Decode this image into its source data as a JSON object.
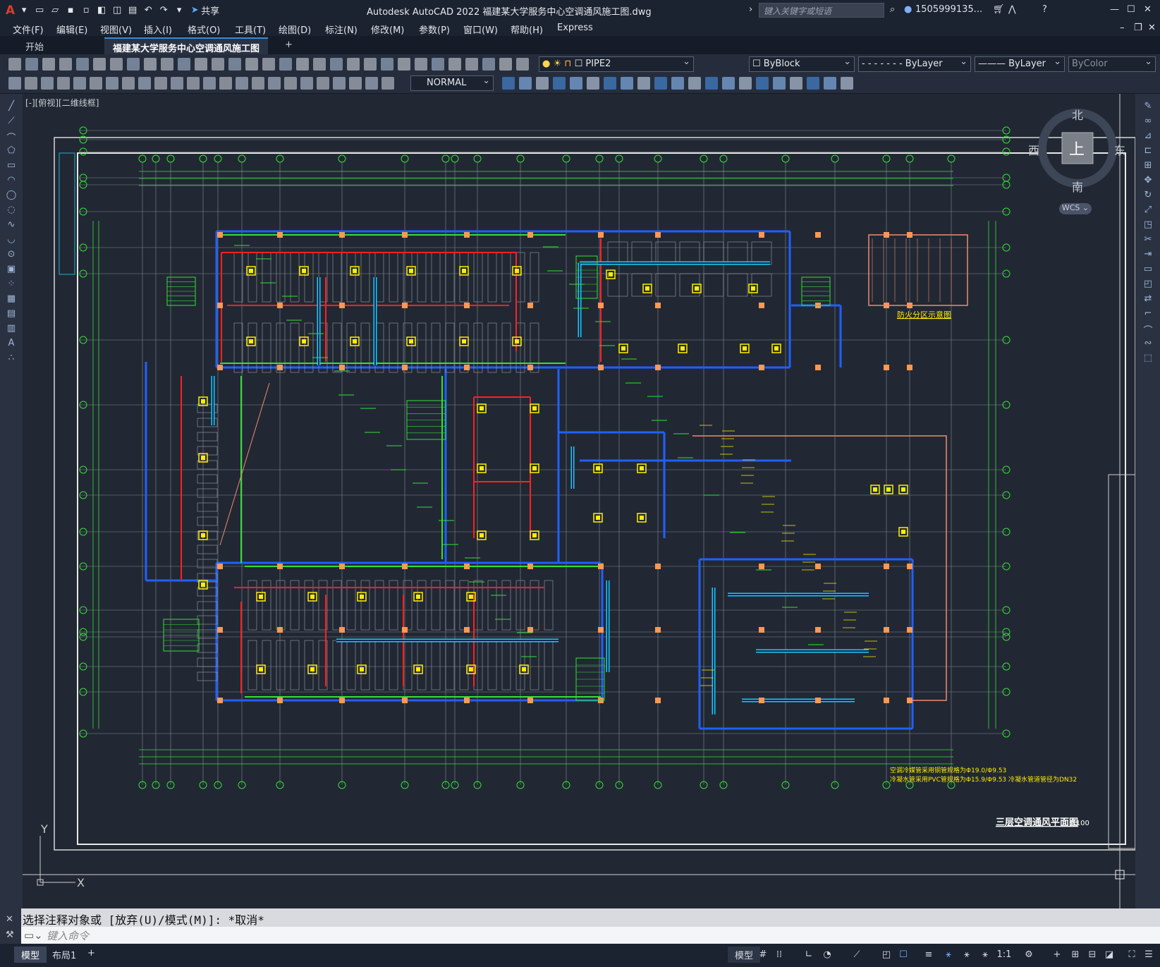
{
  "app": {
    "title": "Autodesk AutoCAD 2022    福建某大学服务中心空调通风施工图.dwg",
    "search_placeholder": "键入关键字或短语",
    "user": "1505999135...",
    "share": "共享"
  },
  "menu": [
    "文件(F)",
    "编辑(E)",
    "视图(V)",
    "插入(I)",
    "格式(O)",
    "工具(T)",
    "绘图(D)",
    "标注(N)",
    "修改(M)",
    "参数(P)",
    "窗口(W)",
    "帮助(H)",
    "Express"
  ],
  "tabs": {
    "start": "开始",
    "drawing": "福建某大学服务中心空调通风施工图*",
    "add": "+"
  },
  "properties": {
    "layer": "PIPE2",
    "color": "ByBlock",
    "linetype": "ByLayer",
    "lineweight": "ByLayer",
    "plotstyle": "ByColor",
    "dimstyle": "NORMAL"
  },
  "viewport": {
    "label": "[-][俯视][二维线框]"
  },
  "viewcube": {
    "north": "北",
    "south": "南",
    "east": "东",
    "west": "西",
    "top": "上",
    "wcs": "WCS"
  },
  "drawing": {
    "title": "三层空调通风平面图",
    "scale": "1:100",
    "key_plan_label": "防火分区示意图",
    "note1": "空调冷媒管采用铜管规格为Φ19.0/Φ9.53",
    "note2": "冷凝水管采用PVC管规格为Φ15.9/Φ9.53   冷凝水管道管径为DN32",
    "ucs_x": "X",
    "ucs_y": "Y"
  },
  "command": {
    "history": "选择注释对象或 [放弃(U)/模式(M)]: *取消*",
    "prompt": "键入命令"
  },
  "status": {
    "model": "模型",
    "layout1": "布局1",
    "model_btn": "模型",
    "scale": "1:1"
  },
  "colors": {
    "green": "#34e034",
    "red": "#ff2020",
    "cyan": "#20d8ff",
    "blue": "#2060ff",
    "yellow": "#ffee00",
    "orange": "#ff9850",
    "white": "#e8e8e8"
  }
}
